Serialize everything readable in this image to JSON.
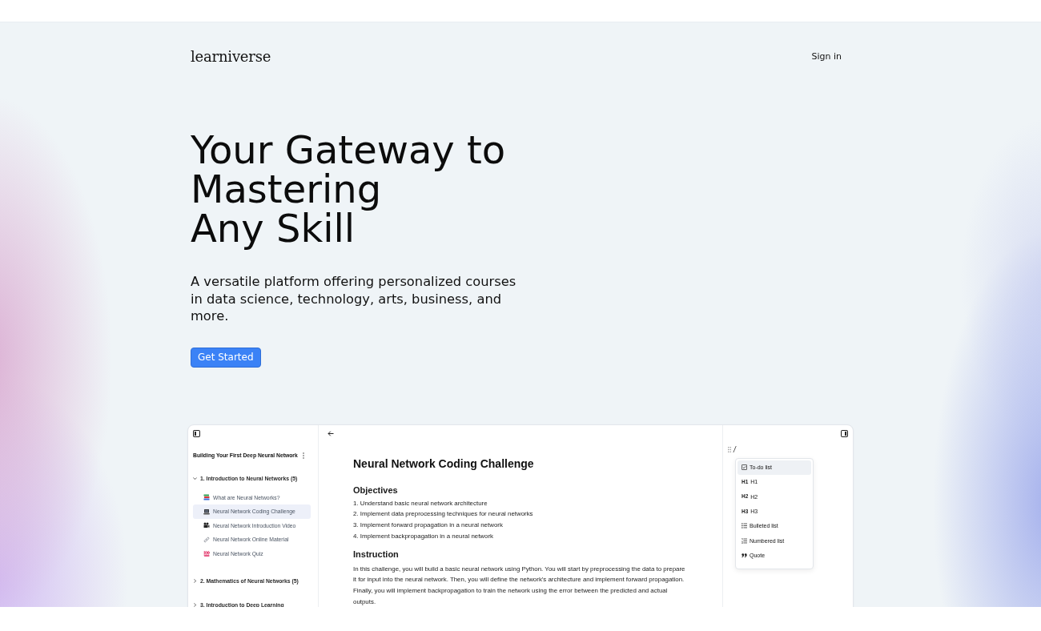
{
  "header": {
    "logo": "learniverse",
    "sign_in": "Sign in"
  },
  "hero": {
    "title_lines": [
      "Your Gateway to",
      "Mastering",
      "Any Skill"
    ],
    "subtitle": "A versatile platform offering personalized courses in data science, technology, arts, business, and more.",
    "cta": "Get Started"
  },
  "app_preview": {
    "sidebar": {
      "course_title": "Building Your First Deep Neural Network",
      "sections": [
        {
          "title": "1. Introduction to Neural Networks (5)",
          "expanded": true,
          "lessons": [
            {
              "kind": "reading",
              "title": "What are Neural Networks?",
              "selected": false
            },
            {
              "kind": "exercise",
              "title": "Neural Network Coding Challenge",
              "selected": true
            },
            {
              "kind": "video",
              "title": "Neural Network Introduction Video",
              "selected": false
            },
            {
              "kind": "resource",
              "title": "Neural Network Online Material",
              "selected": false
            },
            {
              "kind": "quiz",
              "title": "Neural Network Quiz",
              "selected": false
            }
          ]
        },
        {
          "title": "2. Mathematics of Neural Networks (5)",
          "expanded": false
        },
        {
          "title": "3. Introduction to Deep Learning",
          "expanded": false
        }
      ]
    },
    "document": {
      "title": "Neural Network Coding Challenge",
      "objectives": {
        "heading": "Objectives",
        "items": [
          "1. Understand basic neural network architecture",
          "2. Implement data preprocessing techniques for neural networks",
          "3. Implement forward propagation in a neural network",
          "4. Implement backpropagation in a neural network"
        ]
      },
      "instruction": {
        "heading": "Instruction",
        "text": "In this challenge, you will build a basic neural network using Python. You will start by preprocessing the data to prepare it for input into the neural network. Then, you will define the network's architecture and implement forward propagation. Finally, you will implement backpropagation to train the network using the error between the predicted and actual outputs."
      }
    },
    "editor": {
      "typed": "/",
      "menu": [
        {
          "kind": "todo",
          "label": "To-do list",
          "selected": true
        },
        {
          "kind": "heading",
          "badge": "H1",
          "label": "H1",
          "selected": false
        },
        {
          "kind": "heading",
          "badge": "H2",
          "label": "H2",
          "selected": false
        },
        {
          "kind": "heading",
          "badge": "H3",
          "label": "H3",
          "selected": false
        },
        {
          "kind": "bulleted",
          "label": "Bulleted list",
          "selected": false
        },
        {
          "kind": "numbered",
          "label": "Numbered list",
          "selected": false
        },
        {
          "kind": "quote",
          "label": "Quote",
          "selected": false
        }
      ]
    }
  }
}
